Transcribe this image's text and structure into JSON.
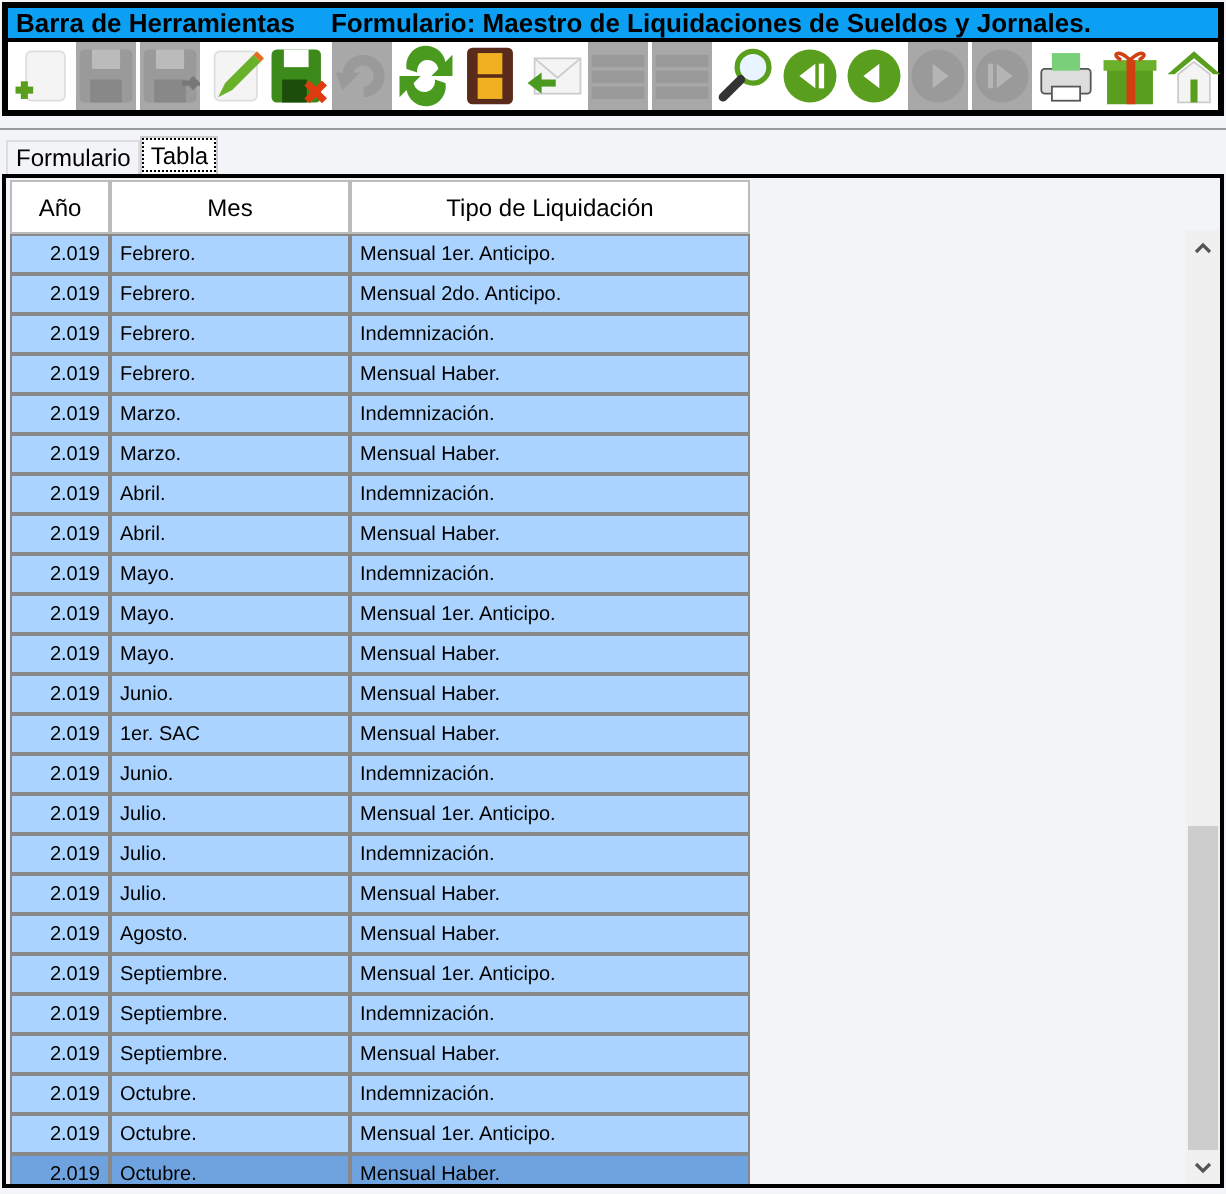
{
  "title_bar": {
    "left": "Barra de Herramientas",
    "right": "Formulario: Maestro de Liquidaciones de Sueldos y Jornales."
  },
  "toolbar": [
    {
      "kind": "add",
      "disabled": false
    },
    {
      "kind": "save",
      "disabled": true
    },
    {
      "kind": "save-as",
      "disabled": true
    },
    {
      "kind": "edit",
      "disabled": false
    },
    {
      "kind": "delete",
      "disabled": false
    },
    {
      "kind": "undo",
      "disabled": true
    },
    {
      "kind": "refresh",
      "disabled": false
    },
    {
      "kind": "film",
      "disabled": false
    },
    {
      "kind": "mail",
      "disabled": false
    },
    {
      "kind": "grid",
      "disabled": true
    },
    {
      "kind": "grid",
      "disabled": true
    },
    {
      "kind": "search",
      "disabled": false
    },
    {
      "kind": "first",
      "disabled": false
    },
    {
      "kind": "previous",
      "disabled": false
    },
    {
      "kind": "next",
      "disabled": true
    },
    {
      "kind": "last",
      "disabled": true
    },
    {
      "kind": "printer",
      "disabled": false
    },
    {
      "kind": "gift",
      "disabled": false
    },
    {
      "kind": "home",
      "disabled": false
    }
  ],
  "tabs": [
    {
      "label": "Formulario",
      "selected": false
    },
    {
      "label": "Tabla",
      "selected": true
    }
  ],
  "table": {
    "columns": [
      "Año",
      "Mes",
      "Tipo de Liquidación"
    ],
    "rows": [
      {
        "cells": [
          "2.019",
          "Febrero.",
          "Mensual 1er. Anticipo."
        ],
        "selected": false
      },
      {
        "cells": [
          "2.019",
          "Febrero.",
          "Mensual 2do. Anticipo."
        ],
        "selected": false
      },
      {
        "cells": [
          "2.019",
          "Febrero.",
          "Indemnización."
        ],
        "selected": false
      },
      {
        "cells": [
          "2.019",
          "Febrero.",
          "Mensual Haber."
        ],
        "selected": false
      },
      {
        "cells": [
          "2.019",
          "Marzo.",
          "Indemnización."
        ],
        "selected": false
      },
      {
        "cells": [
          "2.019",
          "Marzo.",
          "Mensual Haber."
        ],
        "selected": false
      },
      {
        "cells": [
          "2.019",
          "Abril.",
          "Indemnización."
        ],
        "selected": false
      },
      {
        "cells": [
          "2.019",
          "Abril.",
          "Mensual Haber."
        ],
        "selected": false
      },
      {
        "cells": [
          "2.019",
          "Mayo.",
          "Indemnización."
        ],
        "selected": false
      },
      {
        "cells": [
          "2.019",
          "Mayo.",
          "Mensual 1er. Anticipo."
        ],
        "selected": false
      },
      {
        "cells": [
          "2.019",
          "Mayo.",
          "Mensual Haber."
        ],
        "selected": false
      },
      {
        "cells": [
          "2.019",
          "Junio.",
          "Mensual Haber."
        ],
        "selected": false
      },
      {
        "cells": [
          "2.019",
          "1er. SAC",
          "Mensual Haber."
        ],
        "selected": false
      },
      {
        "cells": [
          "2.019",
          "Junio.",
          "Indemnización."
        ],
        "selected": false
      },
      {
        "cells": [
          "2.019",
          "Julio.",
          "Mensual 1er. Anticipo."
        ],
        "selected": false
      },
      {
        "cells": [
          "2.019",
          "Julio.",
          "Indemnización."
        ],
        "selected": false
      },
      {
        "cells": [
          "2.019",
          "Julio.",
          "Mensual Haber."
        ],
        "selected": false
      },
      {
        "cells": [
          "2.019",
          "Agosto.",
          "Mensual Haber."
        ],
        "selected": false
      },
      {
        "cells": [
          "2.019",
          "Septiembre.",
          "Mensual 1er. Anticipo."
        ],
        "selected": false
      },
      {
        "cells": [
          "2.019",
          "Septiembre.",
          "Indemnización."
        ],
        "selected": false
      },
      {
        "cells": [
          "2.019",
          "Septiembre.",
          "Mensual Haber."
        ],
        "selected": false
      },
      {
        "cells": [
          "2.019",
          "Octubre.",
          "Indemnización."
        ],
        "selected": false
      },
      {
        "cells": [
          "2.019",
          "Octubre.",
          "Mensual 1er. Anticipo."
        ],
        "selected": false
      },
      {
        "cells": [
          "2.019",
          "Octubre.",
          "Mensual Haber."
        ],
        "selected": true
      }
    ]
  }
}
